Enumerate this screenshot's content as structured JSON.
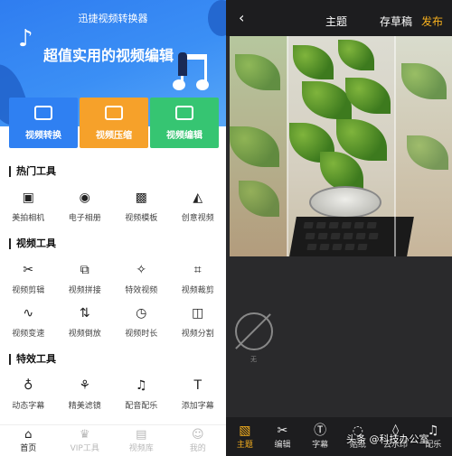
{
  "left": {
    "app_title": "迅捷视频转换器",
    "headline": "超值实用的视频编辑",
    "cards": [
      {
        "label": "视频转换",
        "color": "#2f80f2"
      },
      {
        "label": "视频压缩",
        "color": "#f6a12a"
      },
      {
        "label": "视频编辑",
        "color": "#36c572"
      }
    ],
    "sections": {
      "hot": {
        "title": "热门工具",
        "items": [
          {
            "label": "美拍相机",
            "icon": "heart-camera-icon"
          },
          {
            "label": "电子相册",
            "icon": "film-reel-icon"
          },
          {
            "label": "视频模板",
            "icon": "template-icon"
          },
          {
            "label": "创意视频",
            "icon": "compass-icon"
          }
        ]
      },
      "video": {
        "title": "视频工具",
        "items": [
          {
            "label": "视频剪辑",
            "icon": "scissors-icon"
          },
          {
            "label": "视频拼接",
            "icon": "merge-icon"
          },
          {
            "label": "特效视频",
            "icon": "magic-wand-icon"
          },
          {
            "label": "视频裁剪",
            "icon": "crop-icon"
          },
          {
            "label": "视频变速",
            "icon": "waveform-icon"
          },
          {
            "label": "视频倒放",
            "icon": "reverse-icon"
          },
          {
            "label": "视频时长",
            "icon": "clock-icon"
          },
          {
            "label": "视频分割",
            "icon": "split-icon"
          }
        ]
      },
      "effects": {
        "title": "特效工具",
        "items": [
          {
            "label": "动态字幕",
            "icon": "balloon-icon"
          },
          {
            "label": "精美滤镜",
            "icon": "filter-icon"
          },
          {
            "label": "配音配乐",
            "icon": "music-note-icon"
          },
          {
            "label": "添加字幕",
            "icon": "text-icon"
          }
        ]
      }
    },
    "bottom_nav": [
      {
        "label": "首页",
        "icon": "home-icon",
        "active": true
      },
      {
        "label": "VIP工具",
        "icon": "crown-icon",
        "active": false
      },
      {
        "label": "视频库",
        "icon": "video-library-icon",
        "active": false
      },
      {
        "label": "我的",
        "icon": "user-icon",
        "active": false
      }
    ]
  },
  "right": {
    "back_icon": "chevron-left-icon",
    "title": "主题",
    "save_draft": "存草稿",
    "publish": "发布",
    "accent": "#f6b01e",
    "none_label": "无",
    "toolbar": [
      {
        "label": "主题",
        "icon": "theme-icon",
        "active": true
      },
      {
        "label": "编辑",
        "icon": "scissors-icon",
        "active": false
      },
      {
        "label": "字幕",
        "icon": "text-circle-icon",
        "active": false
      },
      {
        "label": "贴纸",
        "icon": "sticker-icon",
        "active": false
      },
      {
        "label": "去水印",
        "icon": "droplet-icon",
        "active": false
      },
      {
        "label": "配乐",
        "icon": "music-icon",
        "active": false
      }
    ]
  },
  "watermark": "头条 @科技办公室"
}
